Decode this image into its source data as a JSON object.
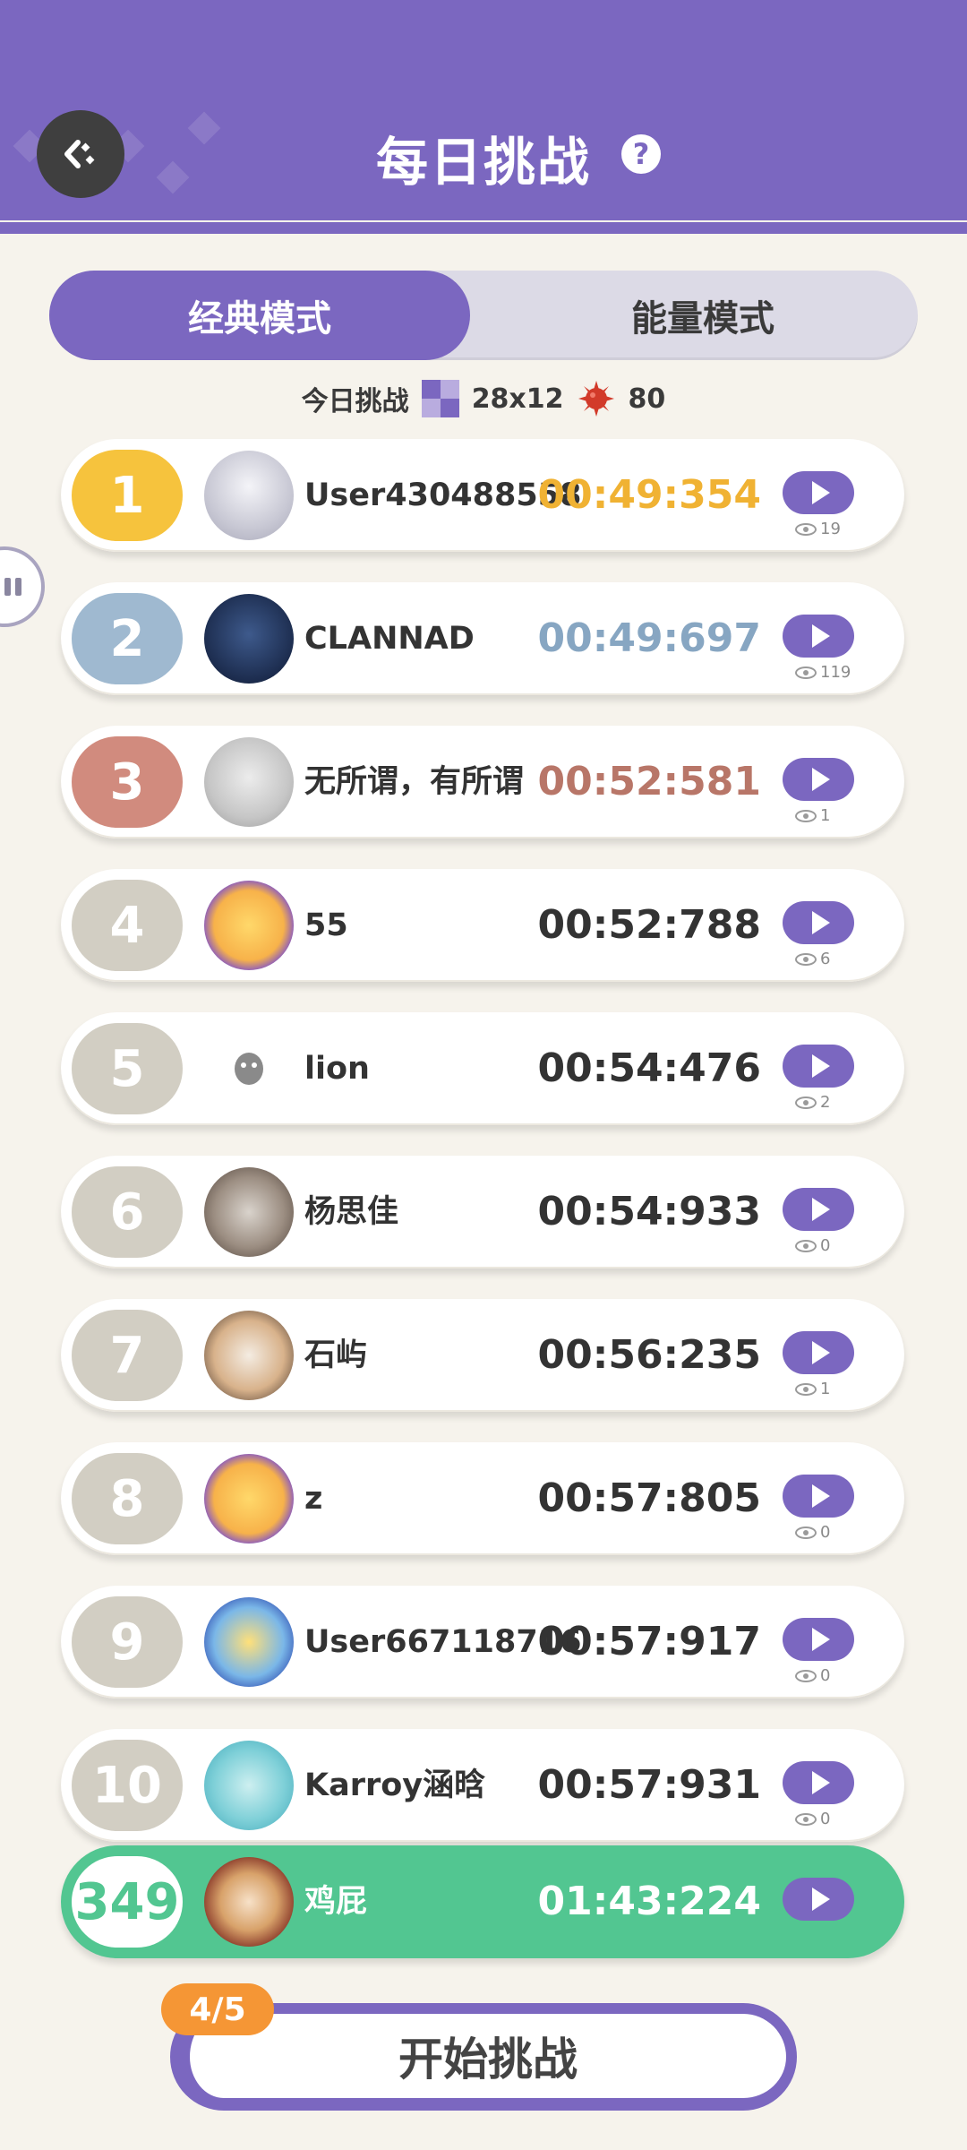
{
  "header": {
    "title": "每日挑战",
    "help_icon": "question-circle-icon",
    "back_icon": "back-arrow-icon"
  },
  "tabs": [
    {
      "label": "经典模式",
      "active": true
    },
    {
      "label": "能量模式",
      "active": false
    }
  ],
  "challenge_info": {
    "label": "今日挑战",
    "board_size": "28x12",
    "mines": "80"
  },
  "colors": {
    "primary": "#7b67c0",
    "gold": "#f6c33d",
    "silver": "#9fb9d0",
    "bronze": "#d18b7e",
    "default_rank": "#d2cec3",
    "me_green": "#52c691"
  },
  "leaderboard": [
    {
      "rank": "1",
      "name": "User430488558",
      "time": "00:49:354",
      "views": "19"
    },
    {
      "rank": "2",
      "name": "CLANNAD",
      "time": "00:49:697",
      "views": "119"
    },
    {
      "rank": "3",
      "name": "无所谓，有所谓",
      "time": "00:52:581",
      "views": "1"
    },
    {
      "rank": "4",
      "name": "55",
      "time": "00:52:788",
      "views": "6"
    },
    {
      "rank": "5",
      "name": "lion",
      "time": "00:54:476",
      "views": "2"
    },
    {
      "rank": "6",
      "name": "杨思佳",
      "time": "00:54:933",
      "views": "0"
    },
    {
      "rank": "7",
      "name": "石屿",
      "time": "00:56:235",
      "views": "1"
    },
    {
      "rank": "8",
      "name": "z",
      "time": "00:57:805",
      "views": "0"
    },
    {
      "rank": "9",
      "name": "User667118716",
      "time": "00:57:917",
      "views": "0"
    },
    {
      "rank": "10",
      "name": "Karroy涵晗",
      "time": "00:57:931",
      "views": "0"
    }
  ],
  "me": {
    "rank": "349",
    "name": "鸡屁",
    "time": "01:43:224"
  },
  "start": {
    "label": "开始挑战",
    "attempts": "4/5"
  }
}
